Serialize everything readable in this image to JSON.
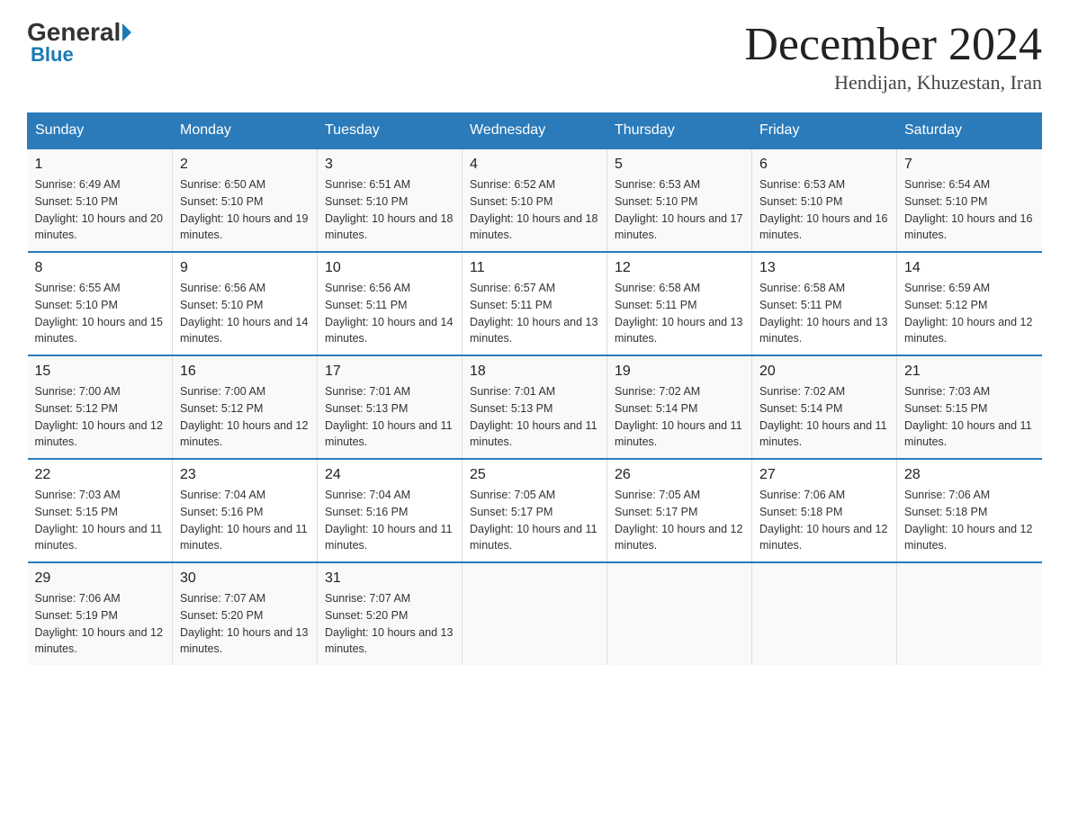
{
  "header": {
    "logo_general": "General",
    "logo_blue": "Blue",
    "month_title": "December 2024",
    "location": "Hendijan, Khuzestan, Iran"
  },
  "days_of_week": [
    "Sunday",
    "Monday",
    "Tuesday",
    "Wednesday",
    "Thursday",
    "Friday",
    "Saturday"
  ],
  "weeks": [
    [
      {
        "day": "1",
        "sunrise": "6:49 AM",
        "sunset": "5:10 PM",
        "daylight": "10 hours and 20 minutes."
      },
      {
        "day": "2",
        "sunrise": "6:50 AM",
        "sunset": "5:10 PM",
        "daylight": "10 hours and 19 minutes."
      },
      {
        "day": "3",
        "sunrise": "6:51 AM",
        "sunset": "5:10 PM",
        "daylight": "10 hours and 18 minutes."
      },
      {
        "day": "4",
        "sunrise": "6:52 AM",
        "sunset": "5:10 PM",
        "daylight": "10 hours and 18 minutes."
      },
      {
        "day": "5",
        "sunrise": "6:53 AM",
        "sunset": "5:10 PM",
        "daylight": "10 hours and 17 minutes."
      },
      {
        "day": "6",
        "sunrise": "6:53 AM",
        "sunset": "5:10 PM",
        "daylight": "10 hours and 16 minutes."
      },
      {
        "day": "7",
        "sunrise": "6:54 AM",
        "sunset": "5:10 PM",
        "daylight": "10 hours and 16 minutes."
      }
    ],
    [
      {
        "day": "8",
        "sunrise": "6:55 AM",
        "sunset": "5:10 PM",
        "daylight": "10 hours and 15 minutes."
      },
      {
        "day": "9",
        "sunrise": "6:56 AM",
        "sunset": "5:10 PM",
        "daylight": "10 hours and 14 minutes."
      },
      {
        "day": "10",
        "sunrise": "6:56 AM",
        "sunset": "5:11 PM",
        "daylight": "10 hours and 14 minutes."
      },
      {
        "day": "11",
        "sunrise": "6:57 AM",
        "sunset": "5:11 PM",
        "daylight": "10 hours and 13 minutes."
      },
      {
        "day": "12",
        "sunrise": "6:58 AM",
        "sunset": "5:11 PM",
        "daylight": "10 hours and 13 minutes."
      },
      {
        "day": "13",
        "sunrise": "6:58 AM",
        "sunset": "5:11 PM",
        "daylight": "10 hours and 13 minutes."
      },
      {
        "day": "14",
        "sunrise": "6:59 AM",
        "sunset": "5:12 PM",
        "daylight": "10 hours and 12 minutes."
      }
    ],
    [
      {
        "day": "15",
        "sunrise": "7:00 AM",
        "sunset": "5:12 PM",
        "daylight": "10 hours and 12 minutes."
      },
      {
        "day": "16",
        "sunrise": "7:00 AM",
        "sunset": "5:12 PM",
        "daylight": "10 hours and 12 minutes."
      },
      {
        "day": "17",
        "sunrise": "7:01 AM",
        "sunset": "5:13 PM",
        "daylight": "10 hours and 11 minutes."
      },
      {
        "day": "18",
        "sunrise": "7:01 AM",
        "sunset": "5:13 PM",
        "daylight": "10 hours and 11 minutes."
      },
      {
        "day": "19",
        "sunrise": "7:02 AM",
        "sunset": "5:14 PM",
        "daylight": "10 hours and 11 minutes."
      },
      {
        "day": "20",
        "sunrise": "7:02 AM",
        "sunset": "5:14 PM",
        "daylight": "10 hours and 11 minutes."
      },
      {
        "day": "21",
        "sunrise": "7:03 AM",
        "sunset": "5:15 PM",
        "daylight": "10 hours and 11 minutes."
      }
    ],
    [
      {
        "day": "22",
        "sunrise": "7:03 AM",
        "sunset": "5:15 PM",
        "daylight": "10 hours and 11 minutes."
      },
      {
        "day": "23",
        "sunrise": "7:04 AM",
        "sunset": "5:16 PM",
        "daylight": "10 hours and 11 minutes."
      },
      {
        "day": "24",
        "sunrise": "7:04 AM",
        "sunset": "5:16 PM",
        "daylight": "10 hours and 11 minutes."
      },
      {
        "day": "25",
        "sunrise": "7:05 AM",
        "sunset": "5:17 PM",
        "daylight": "10 hours and 11 minutes."
      },
      {
        "day": "26",
        "sunrise": "7:05 AM",
        "sunset": "5:17 PM",
        "daylight": "10 hours and 12 minutes."
      },
      {
        "day": "27",
        "sunrise": "7:06 AM",
        "sunset": "5:18 PM",
        "daylight": "10 hours and 12 minutes."
      },
      {
        "day": "28",
        "sunrise": "7:06 AM",
        "sunset": "5:18 PM",
        "daylight": "10 hours and 12 minutes."
      }
    ],
    [
      {
        "day": "29",
        "sunrise": "7:06 AM",
        "sunset": "5:19 PM",
        "daylight": "10 hours and 12 minutes."
      },
      {
        "day": "30",
        "sunrise": "7:07 AM",
        "sunset": "5:20 PM",
        "daylight": "10 hours and 13 minutes."
      },
      {
        "day": "31",
        "sunrise": "7:07 AM",
        "sunset": "5:20 PM",
        "daylight": "10 hours and 13 minutes."
      },
      null,
      null,
      null,
      null
    ]
  ],
  "labels": {
    "sunrise_prefix": "Sunrise: ",
    "sunset_prefix": "Sunset: ",
    "daylight_prefix": "Daylight: "
  }
}
